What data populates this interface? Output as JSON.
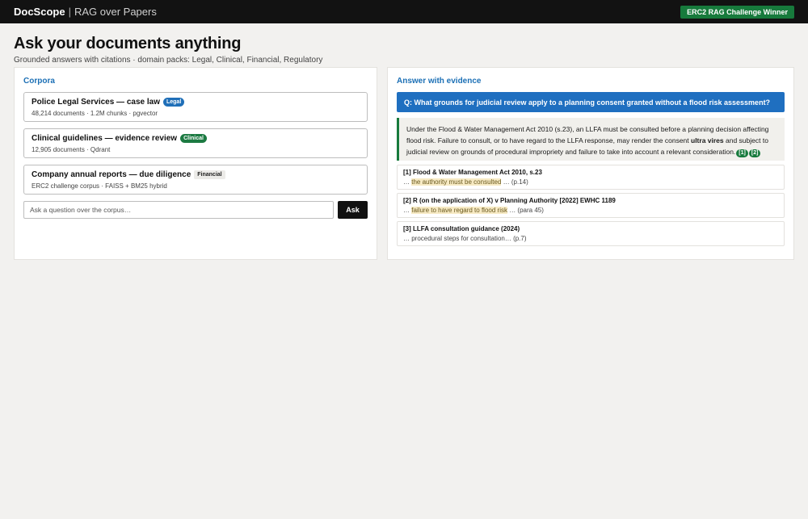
{
  "header": {
    "brand": "DocScope",
    "separator": "|",
    "subtitle": "RAG over Papers",
    "badge": "ERC2 RAG Challenge Winner"
  },
  "hero": {
    "title": "Ask your documents anything",
    "subtitle": "Grounded answers with citations · domain packs: Legal, Clinical, Financial, Regulatory"
  },
  "corpora": {
    "title": "Corpora",
    "items": [
      {
        "name": "Police Legal Services — case law",
        "tag": "Legal",
        "meta": "48,214 documents · 1.2M chunks · pgvector"
      },
      {
        "name": "Clinical guidelines — evidence review",
        "tag": "Clinical",
        "meta": "12,905 documents · Qdrant"
      },
      {
        "name": "Company annual reports — due diligence",
        "tag": "Financial",
        "meta": "ERC2 challenge corpus · FAISS + BM25 hybrid"
      }
    ],
    "ask_placeholder": "Ask a question over the corpus…",
    "ask_value": "",
    "ask_button": "Ask"
  },
  "answer": {
    "title": "Answer with evidence",
    "question": "Q: What grounds for judicial review apply to a planning consent granted without a flood risk assessment?",
    "text_before": "Under the Flood & Water Management Act 2010 (s.23), an LLFA must be consulted before a planning decision affecting flood risk. Failure to consult, or to have regard to the LLFA response, may render the consent ",
    "text_bold": "ultra vires",
    "text_after": " and subject to judicial review on grounds of procedural impropriety and failure to take into account a relevant consideration.",
    "citations": [
      "[1]",
      "[2]"
    ],
    "sources": [
      {
        "title": "[1] Flood & Water Management Act 2010, s.23",
        "prefix": "… ",
        "highlight": "the authority must be consulted",
        "suffix": " … (p.14)"
      },
      {
        "title": "[2] R (on the application of X) v Planning Authority [2022] EWHC 1189",
        "prefix": "… ",
        "highlight": "failure to have regard to flood risk",
        "suffix": " … (para 45)"
      },
      {
        "title": "[3] LLFA consultation guidance (2024)",
        "prefix": "… procedural steps for consultation… (p.7)",
        "highlight": "",
        "suffix": ""
      }
    ]
  },
  "colors": {
    "topbar": "#121212",
    "accent_blue": "#1f6fc0",
    "accent_green": "#177a3c",
    "highlight": "#f7eac4"
  }
}
